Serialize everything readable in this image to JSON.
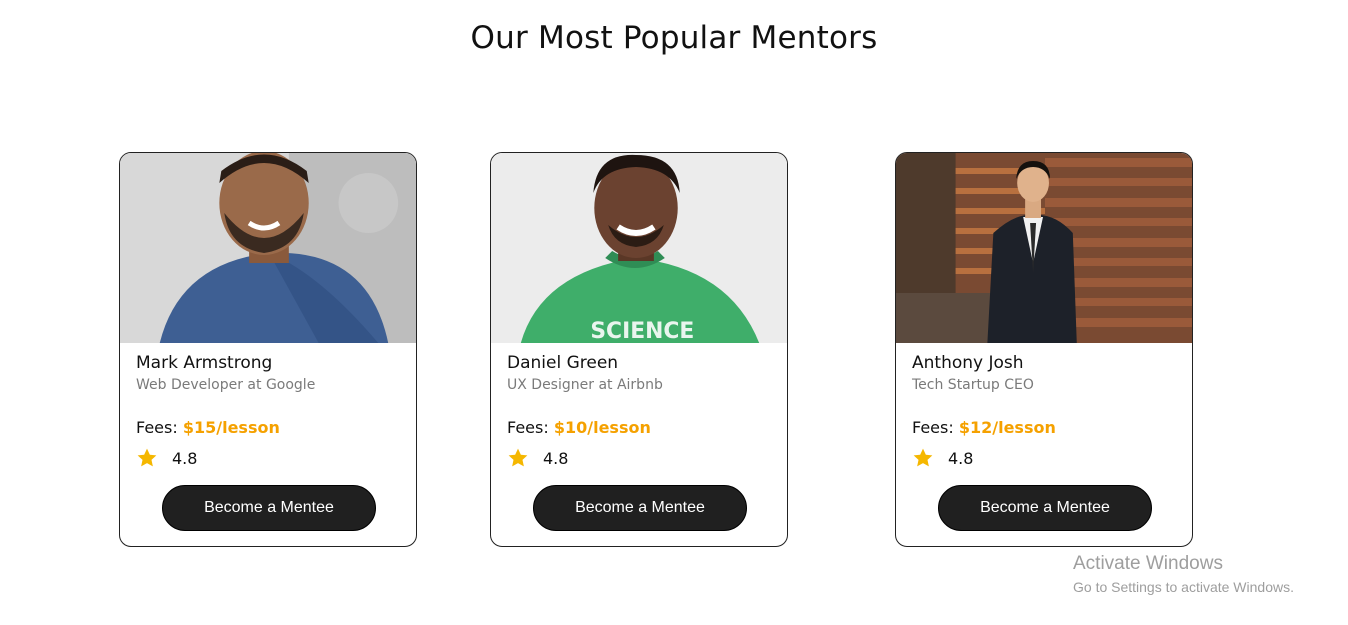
{
  "page": {
    "title": "Our Most Popular Mentors"
  },
  "mentors": [
    {
      "name": "Mark Armstrong",
      "role": "Web Developer at Google",
      "fees_label": "Fees:",
      "price": "$15/lesson",
      "rating": "4.8",
      "button": "Become a Mentee",
      "photo": "mentor-photo-smiling-man-blue-shirt"
    },
    {
      "name": "Daniel Green",
      "role": "UX Designer at Airbnb",
      "fees_label": "Fees:",
      "price": "$10/lesson",
      "rating": "4.8",
      "button": "Become a Mentee",
      "photo": "mentor-photo-smiling-man-green-shirt"
    },
    {
      "name": "Anthony Josh",
      "role": "Tech Startup CEO",
      "fees_label": "Fees:",
      "price": "$12/lesson",
      "rating": "4.8",
      "button": "Become a Mentee",
      "photo": "mentor-photo-man-in-suit-wood-wall"
    }
  ],
  "icons": {
    "rating": "star-icon"
  },
  "colors": {
    "accent": "#f5a100",
    "star": "#f5b700",
    "button_bg": "#202020"
  },
  "watermark": {
    "title": "Activate Windows",
    "subtitle": "Go to Settings to activate Windows."
  }
}
